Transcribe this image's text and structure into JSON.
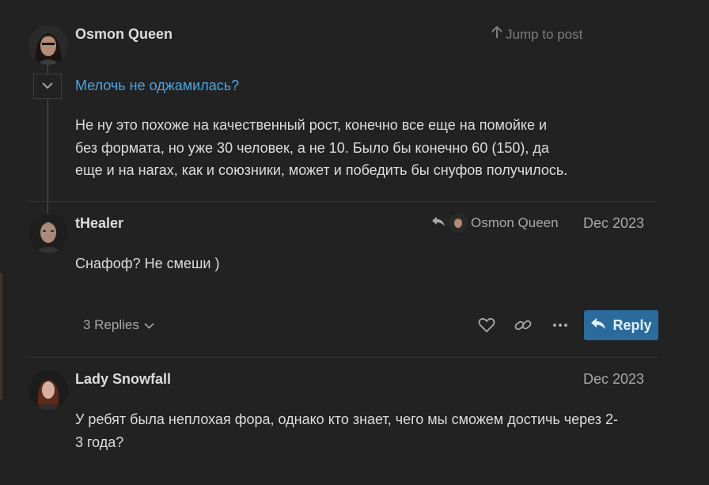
{
  "posts": [
    {
      "username": "Osmon Queen",
      "jump_label": "Jump to post",
      "reply_title": "Мелочь не оджамилась?",
      "body": "Не ну это похоже на качественный рост, конечно все еще на помойке и\nбез формата, но уже 30 человек, а не 10. Было бы конечно 60 (150), да\nеще и на нагах, как и союзники, может и победить бы снуфов получилось."
    },
    {
      "username": "tHealer",
      "reply_to_user": "Osmon Queen",
      "date": "Dec 2023",
      "body": "Снафоф? Не смеши )",
      "replies_label": "3 Replies",
      "reply_button_label": "Reply"
    },
    {
      "username": "Lady Snowfall",
      "date": "Dec 2023",
      "body": "У ребят была неплохая фора, однако кто знает, чего мы сможем достичь через 2-\n3 года?"
    }
  ],
  "colors": {
    "background": "#222222",
    "link": "#4ea3e0",
    "reply_button": "#2b6b9c"
  },
  "icons": [
    "arrow-up-icon",
    "chevron-down-icon",
    "reply-arrow-icon",
    "heart-icon",
    "link-icon",
    "more-icon"
  ]
}
